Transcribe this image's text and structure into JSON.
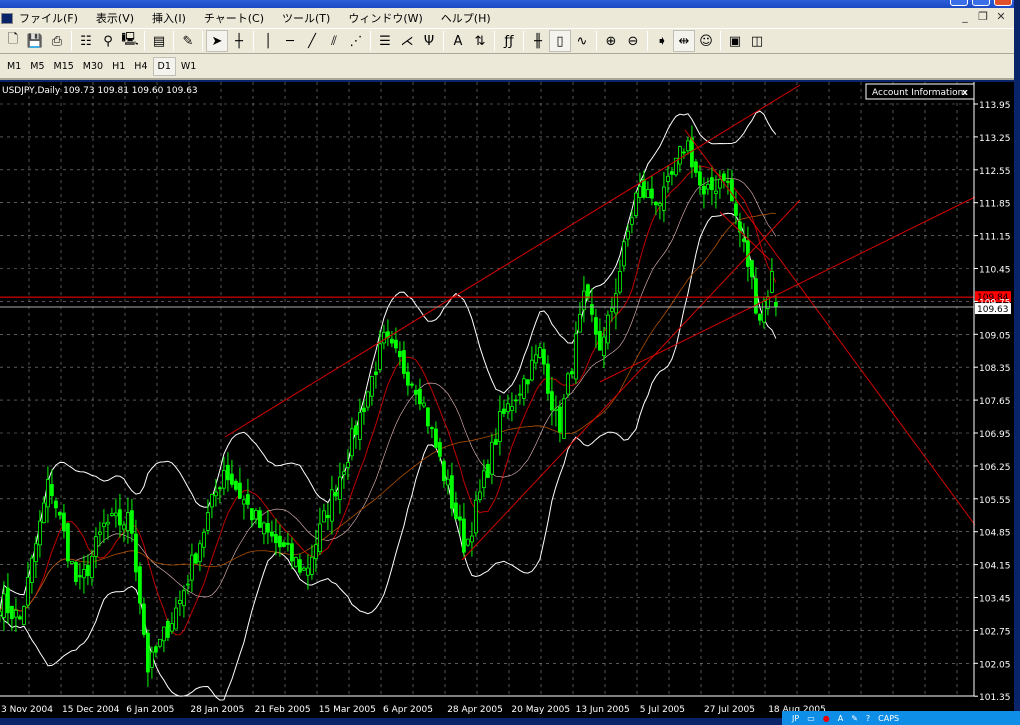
{
  "menu": [
    "ファイル(F)",
    "表示(V)",
    "挿入(I)",
    "チャート(C)",
    "ツール(T)",
    "ウィンドウ(W)",
    "ヘルプ(H)"
  ],
  "mdi_controls": [
    "_",
    "❐",
    "✕"
  ],
  "toolbar_icons": [
    {
      "name": "new-chart-icon",
      "glyph": "🗋"
    },
    {
      "name": "save-icon",
      "glyph": "💾"
    },
    {
      "name": "print-icon",
      "glyph": "⎙"
    },
    "sep",
    {
      "name": "market-watch-icon",
      "glyph": "☷"
    },
    {
      "name": "navigator-icon",
      "glyph": "⚲"
    },
    {
      "name": "terminal-icon",
      "glyph": "🖳"
    },
    "sep",
    {
      "name": "strategy-tester-icon",
      "glyph": "▤"
    },
    "sep",
    {
      "name": "metaeditor-icon",
      "glyph": "✎"
    },
    "sep",
    {
      "name": "cursor-icon",
      "glyph": "➤",
      "active": true
    },
    {
      "name": "crosshair-icon",
      "glyph": "┼"
    },
    "sep",
    {
      "name": "vertical-line-icon",
      "glyph": "│"
    },
    {
      "name": "horizontal-line-icon",
      "glyph": "─"
    },
    {
      "name": "trendline-icon",
      "glyph": "╱"
    },
    {
      "name": "channel-icon",
      "glyph": "⫽"
    },
    {
      "name": "gann-fan-icon",
      "glyph": "⋰"
    },
    "sep",
    {
      "name": "fibonacci-icon",
      "glyph": "☰"
    },
    {
      "name": "pitchfork-icon",
      "glyph": "⋌"
    },
    {
      "name": "cycle-lines-icon",
      "glyph": "Ψ"
    },
    "sep",
    {
      "name": "text-icon",
      "glyph": "A"
    },
    {
      "name": "arrows-icon",
      "glyph": "⇅"
    },
    "sep",
    {
      "name": "fonts-icon",
      "glyph": "ƒƒ"
    },
    "sep",
    {
      "name": "bar-chart-icon",
      "glyph": "╫"
    },
    {
      "name": "candlestick-icon",
      "glyph": "▯",
      "active": true
    },
    {
      "name": "line-chart-icon",
      "glyph": "∿"
    },
    "sep",
    {
      "name": "zoom-in-icon",
      "glyph": "⊕"
    },
    {
      "name": "zoom-out-icon",
      "glyph": "⊖"
    },
    "sep",
    {
      "name": "autoscroll-icon",
      "glyph": "➧"
    },
    {
      "name": "chart-shift-icon",
      "glyph": "⇹",
      "active": true
    },
    {
      "name": "expert-advisor-icon",
      "glyph": "☺"
    },
    "sep",
    {
      "name": "periods-icon",
      "glyph": "▣"
    },
    {
      "name": "templates-icon",
      "glyph": "◫"
    }
  ],
  "timeframes": [
    {
      "label": "M1"
    },
    {
      "label": "M5"
    },
    {
      "label": "M15"
    },
    {
      "label": "M30"
    },
    {
      "label": "H1"
    },
    {
      "label": "H4"
    },
    {
      "label": "D1",
      "active": true
    },
    {
      "label": "W1"
    }
  ],
  "chart": {
    "symbol_info": "USDJPY,Daily  109.73 109.81 109.60 109.63",
    "account_panel": "Account Information",
    "account_close": "x",
    "bid_label": "109.84",
    "last_label": "109.63",
    "colors": {
      "bull": "#00ff00",
      "bear": "#00ff00",
      "bands": "#ffffff",
      "ma": "#c00000",
      "trend": "#d40000",
      "grid": "#8c8c8c",
      "bid": "#ff0000"
    }
  },
  "chart_data": {
    "type": "candlestick",
    "symbol": "USDJPY",
    "timeframe": "Daily",
    "last_ohlc": {
      "open": 109.73,
      "high": 109.81,
      "low": 109.6,
      "close": 109.63
    },
    "y_ticks": [
      "113.95",
      "113.25",
      "112.55",
      "111.85",
      "111.15",
      "110.45",
      "109.75",
      "109.05",
      "108.35",
      "107.65",
      "106.95",
      "106.25",
      "105.55",
      "104.85",
      "104.15",
      "103.45",
      "102.75",
      "102.05",
      "101.35"
    ],
    "ylim": [
      101.35,
      113.95
    ],
    "x_ticks": [
      "3 Nov 2004",
      "15 Dec 2004",
      "6 Jan 2005",
      "28 Jan 2005",
      "21 Feb 2005",
      "15 Mar 2005",
      "6 Apr 2005",
      "28 Apr 2005",
      "20 May 2005",
      "13 Jun 2005",
      "5 Jul 2005",
      "27 Jul 2005",
      "18 Aug 2005"
    ],
    "approx_close_path": [
      [
        "2004-11-24",
        103.4
      ],
      [
        "2004-12-01",
        102.97
      ],
      [
        "2004-12-11",
        105.95
      ],
      [
        "2004-12-21",
        103.6
      ],
      [
        "2004-12-30",
        105.0
      ],
      [
        "2005-01-08",
        105.1
      ],
      [
        "2005-01-14",
        101.9
      ],
      [
        "2005-01-25",
        103.4
      ],
      [
        "2005-02-09",
        106.2
      ],
      [
        "2005-02-22",
        104.9
      ],
      [
        "2005-03-09",
        104.0
      ],
      [
        "2005-03-24",
        106.6
      ],
      [
        "2005-04-05",
        108.9
      ],
      [
        "2005-04-17",
        107.9
      ],
      [
        "2005-05-03",
        104.5
      ],
      [
        "2005-05-15",
        107.2
      ],
      [
        "2005-05-29",
        108.7
      ],
      [
        "2005-06-04",
        107.0
      ],
      [
        "2005-06-13",
        109.8
      ],
      [
        "2005-06-19",
        108.7
      ],
      [
        "2005-07-01",
        112.1
      ],
      [
        "2005-07-10",
        111.9
      ],
      [
        "2005-07-18",
        113.2
      ],
      [
        "2005-07-24",
        111.9
      ],
      [
        "2005-07-31",
        112.5
      ],
      [
        "2005-08-08",
        110.6
      ],
      [
        "2005-08-12",
        109.4
      ],
      [
        "2005-08-17",
        110.4
      ],
      [
        "2005-08-19",
        109.63
      ]
    ],
    "indicators": [
      "Bollinger Bands",
      "Moving Average",
      "Moving Average"
    ],
    "bid_line": 109.84,
    "grid": true
  },
  "taskbar": {
    "lang": "JP",
    "caps": "CAPS"
  }
}
